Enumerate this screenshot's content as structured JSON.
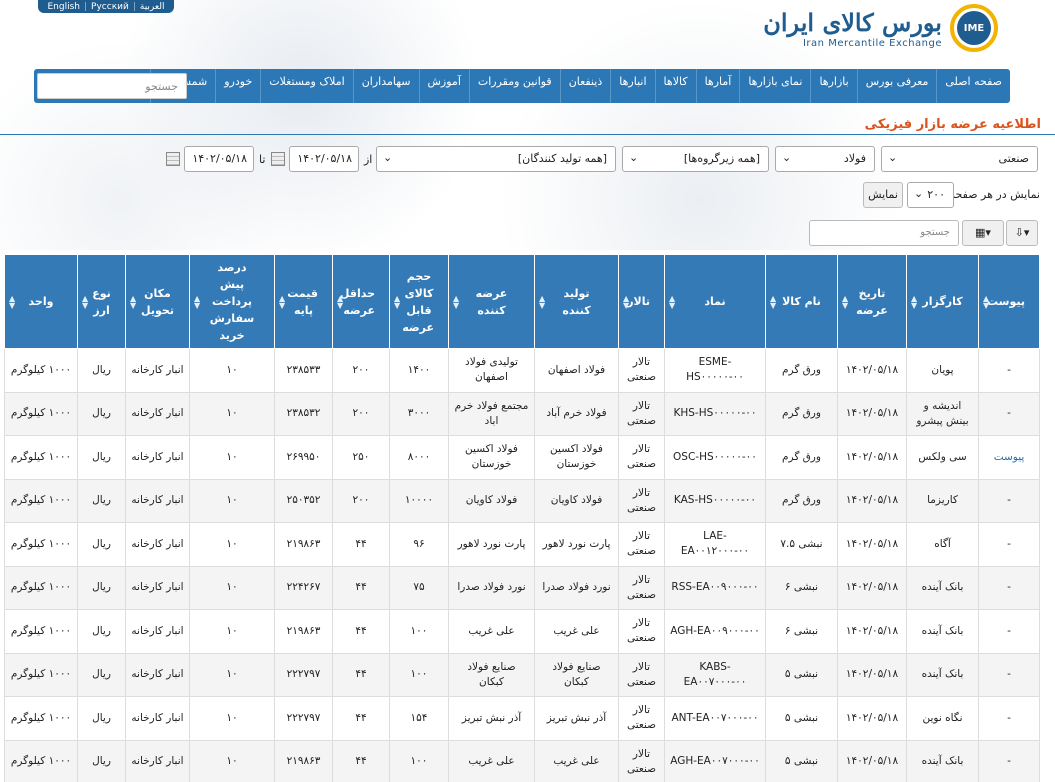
{
  "languages": [
    "English",
    "Русский",
    "العربیة"
  ],
  "logo": {
    "fa": "بورس کالای ایران",
    "en": "Iran Mercantile Exchange",
    "emblem_text": "IME"
  },
  "nav": {
    "items": [
      "صفحه اصلی",
      "معرفی بورس",
      "بازارها",
      "نمای بازارها",
      "آمارها",
      "کالاها",
      "انبارها",
      "ذینفعان",
      "قوانین ومقررات",
      "آموزش",
      "سهامداران",
      "املاک ومستغلات",
      "خودرو",
      "شمش طلا"
    ],
    "search_placeholder": "جستجو"
  },
  "page_title": "اطلاعیه عرضه بازار فیزیکی",
  "filters": {
    "market": "صنعتی",
    "group": "فولاد",
    "subgroup": "[همه زیرگروه‌ها]",
    "producer": "[همه تولید کنندگان]",
    "from_label": "از",
    "to_label": "تا",
    "date_from": "۱۴۰۲/۰۵/۱۸",
    "date_to": "۱۴۰۲/۰۵/۱۸",
    "page_size_label": "نمایش در هر صفحه",
    "page_size": "۲۰۰",
    "show_button": "نمایش",
    "table_search_placeholder": "جستجو"
  },
  "table": {
    "columns": [
      "پیوست",
      "کارگزار",
      "تاریخ عرضه",
      "نام کالا",
      "نماد",
      "تالار",
      "تولید کننده",
      "عرضه کننده",
      "حجم کالای قابل عرضه",
      "حداقل عرضه",
      "قیمت پایه",
      "درصد پیش پرداخت سفارش خرید",
      "مکان تحویل",
      "نوع ارز",
      "واحد"
    ],
    "rows": [
      [
        "-",
        "پویان",
        "۱۴۰۲/۰۵/۱۸",
        "ورق گرم",
        "ESME-HS۰۰۰۰۰-۰۰",
        "تالار صنعتی",
        "فولاد اصفهان",
        "تولیدی فولاد اصفهان",
        "۱۴۰۰",
        "۲۰۰",
        "۲۳۸۵۳۳",
        "۱۰",
        "انبار کارخانه",
        "ریال",
        "۱۰۰۰ کیلوگرم"
      ],
      [
        "-",
        "اندیشه و بینش پیشرو",
        "۱۴۰۲/۰۵/۱۸",
        "ورق گرم",
        "KHS-HS۰۰۰۰۰-۰۰",
        "تالار صنعتی",
        "فولاد خرم آباد",
        "مجتمع فولاد خرم اباد",
        "۳۰۰۰",
        "۲۰۰",
        "۲۳۸۵۳۲",
        "۱۰",
        "انبار کارخانه",
        "ریال",
        "۱۰۰۰ کیلوگرم"
      ],
      [
        "پیوست",
        "سی ولکس",
        "۱۴۰۲/۰۵/۱۸",
        "ورق گرم",
        "OSC-HS۰۰۰۰۰-۰۰",
        "تالار صنعتی",
        "فولاد اکسین خوزستان",
        "فولاد اکسین خوزستان",
        "۸۰۰۰",
        "۲۵۰",
        "۲۶۹۹۵۰",
        "۱۰",
        "انبار کارخانه",
        "ریال",
        "۱۰۰۰ کیلوگرم"
      ],
      [
        "-",
        "کاریزما",
        "۱۴۰۲/۰۵/۱۸",
        "ورق گرم",
        "KAS-HS۰۰۰۰۰-۰۰",
        "تالار صنعتی",
        "فولاد کاویان",
        "فولاد کاویان",
        "۱۰۰۰۰",
        "۲۰۰",
        "۲۵۰۳۵۲",
        "۱۰",
        "انبار کارخانه",
        "ریال",
        "۱۰۰۰ کیلوگرم"
      ],
      [
        "-",
        "آگاه",
        "۱۴۰۲/۰۵/۱۸",
        "نبشی ۷.۵",
        "LAE-EA۰۰۱۲۰۰۰-۰۰",
        "تالار صنعتی",
        "پارت نورد لاهور",
        "پارت نورد لاهور",
        "۹۶",
        "۴۴",
        "۲۱۹۸۶۳",
        "۱۰",
        "انبار کارخانه",
        "ریال",
        "۱۰۰۰ کیلوگرم"
      ],
      [
        "-",
        "بانک آینده",
        "۱۴۰۲/۰۵/۱۸",
        "نبشی ۶",
        "RSS-EA۰۰۹۰۰۰-۰۰",
        "تالار صنعتی",
        "نورد فولاد صدرا",
        "نورد فولاد صدرا",
        "۷۵",
        "۴۴",
        "۲۲۴۲۶۷",
        "۱۰",
        "انبار کارخانه",
        "ریال",
        "۱۰۰۰ کیلوگرم"
      ],
      [
        "-",
        "بانک آینده",
        "۱۴۰۲/۰۵/۱۸",
        "نبشی ۶",
        "AGH-EA۰۰۹۰۰۰-۰۰",
        "تالار صنعتی",
        "علی غریب",
        "علی غریب",
        "۱۰۰",
        "۴۴",
        "۲۱۹۸۶۳",
        "۱۰",
        "انبار کارخانه",
        "ریال",
        "۱۰۰۰ کیلوگرم"
      ],
      [
        "-",
        "بانک آینده",
        "۱۴۰۲/۰۵/۱۸",
        "نبشی ۵",
        "KABS-EA۰۰۷۰۰۰-۰۰",
        "تالار صنعتی",
        "صنایع فولاد کبکان",
        "صنایع فولاد کبکان",
        "۱۰۰",
        "۴۴",
        "۲۲۲۷۹۷",
        "۱۰",
        "انبار کارخانه",
        "ریال",
        "۱۰۰۰ کیلوگرم"
      ],
      [
        "-",
        "نگاه نوین",
        "۱۴۰۲/۰۵/۱۸",
        "نبشی ۵",
        "ANT-EA۰۰۷۰۰۰-۰۰",
        "تالار صنعتی",
        "آذر نبش تبریز",
        "آذر نبش تبریز",
        "۱۵۴",
        "۴۴",
        "۲۲۲۷۹۷",
        "۱۰",
        "انبار کارخانه",
        "ریال",
        "۱۰۰۰ کیلوگرم"
      ],
      [
        "-",
        "بانک آینده",
        "۱۴۰۲/۰۵/۱۸",
        "نبشی ۵",
        "AGH-EA۰۰۷۰۰۰-۰۰",
        "تالار صنعتی",
        "علی غریب",
        "علی غریب",
        "۱۰۰",
        "۴۴",
        "۲۱۹۸۶۳",
        "۱۰",
        "انبار کارخانه",
        "ریال",
        "۱۰۰۰ کیلوگرم"
      ]
    ]
  },
  "colors": {
    "nav": "#2c77b6",
    "header": "#337ab7",
    "title": "#d9541e",
    "link": "#2c6fad",
    "logo": "#1f5c8f",
    "emblem_ring": "#f2b400"
  }
}
